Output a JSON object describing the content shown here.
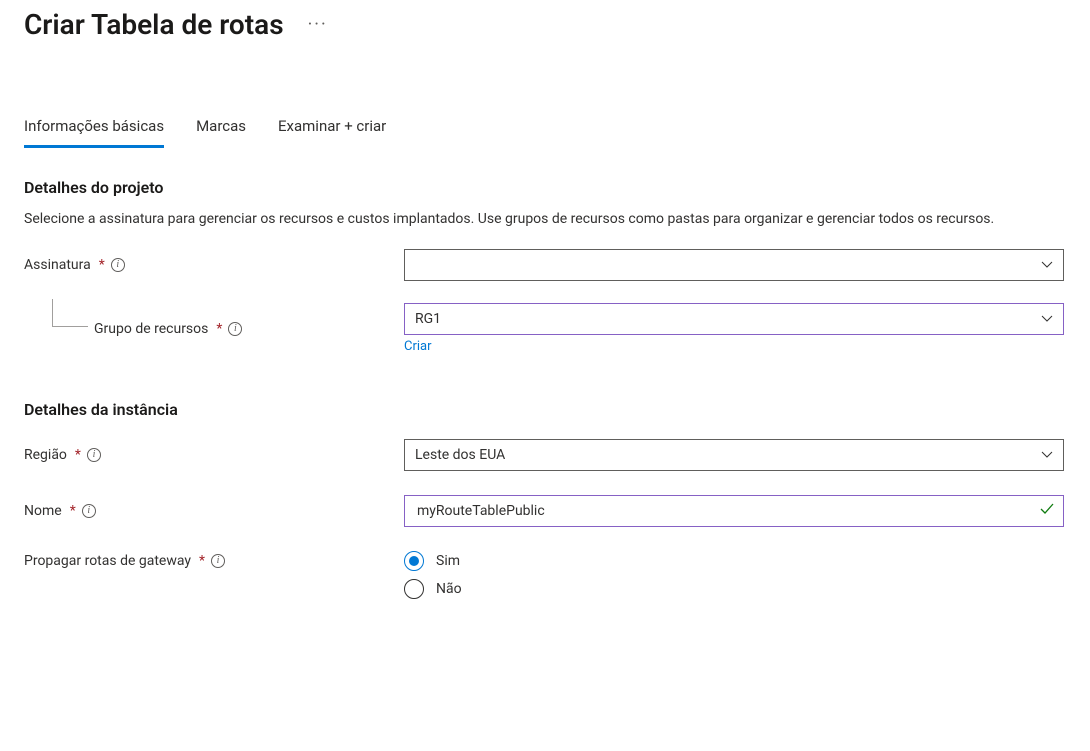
{
  "header": {
    "title": "Criar Tabela de rotas"
  },
  "tabs": {
    "basics": "Informações básicas",
    "tags": "Marcas",
    "review": "Examinar + criar"
  },
  "project": {
    "heading": "Detalhes do projeto",
    "description": "Selecione a assinatura para gerenciar os recursos e custos implantados. Use grupos de recursos como pastas para organizar e gerenciar todos os recursos.",
    "subscription_label": "Assinatura",
    "subscription_value": "",
    "rg_label": "Grupo de recursos",
    "rg_value": "RG1",
    "rg_create_link": "Criar"
  },
  "instance": {
    "heading": "Detalhes da instância",
    "region_label": "Região",
    "region_value": "Leste dos EUA",
    "name_label": "Nome",
    "name_value": "myRouteTablePublic",
    "propagate_label": "Propagar rotas de gateway",
    "radio_yes": "Sim",
    "radio_no": "Não",
    "propagate_selected": "yes"
  }
}
